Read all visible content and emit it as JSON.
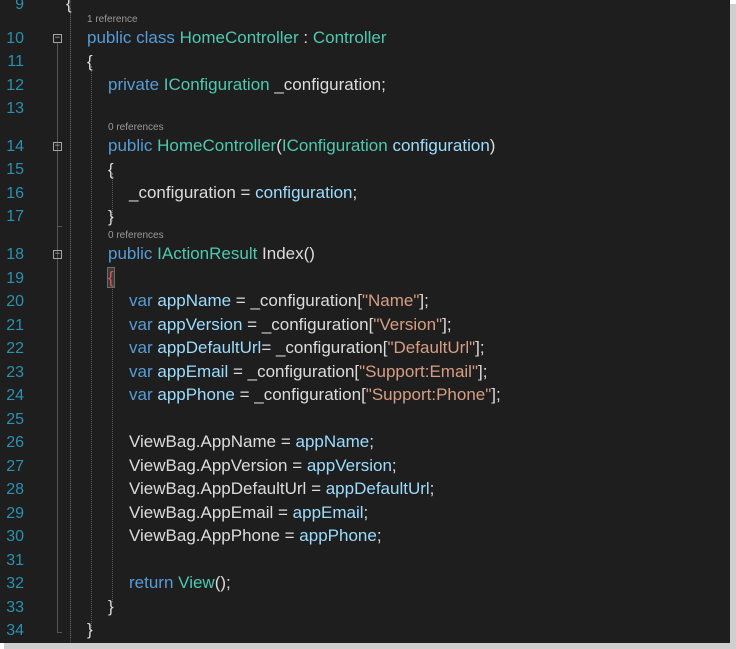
{
  "line_numbers": {
    "l9": "9",
    "l10": "10",
    "l11": "11",
    "l12": "12",
    "l13": "13",
    "l14": "14",
    "l15": "15",
    "l16": "16",
    "l17": "17",
    "l18": "18",
    "l19": "19",
    "l20": "20",
    "l21": "21",
    "l22": "22",
    "l23": "23",
    "l24": "24",
    "l25": "25",
    "l26": "26",
    "l27": "27",
    "l28": "28",
    "l29": "29",
    "l30": "30",
    "l31": "31",
    "l32": "32",
    "l33": "33",
    "l34": "34"
  },
  "codelens": {
    "class_refs": "1 reference",
    "ctor_refs": "0 references",
    "index_refs": "0 references"
  },
  "tokens": {
    "open_brace": "{",
    "close_brace": "}",
    "kw_public": "public",
    "kw_class": "class",
    "kw_private": "private",
    "kw_var": "var",
    "kw_return": "return",
    "home_controller": "HomeController",
    "colon": " : ",
    "controller": "Controller",
    "iconfiguration": "IConfiguration",
    "field_decl": " _configuration;",
    "open_paren": "(",
    "param_configuration": "configuration",
    "close_paren": ")",
    "assign_lhs": "_configuration = ",
    "assign_end": ";",
    "iactionresult": "IActionResult",
    "index_sig": " Index()",
    "app_name": "appName",
    "app_version": "appVersion",
    "app_default_url": "appDefaultUrl",
    "app_email": "appEmail",
    "app_phone": "appPhone",
    "eq": " = ",
    "eq_tight": "= ",
    "config_open": "_configuration[",
    "config_close": "];",
    "str_name": "\"Name\"",
    "str_version": "\"Version\"",
    "str_default_url": "\"DefaultUrl\"",
    "str_support_email": "\"Support:Email\"",
    "str_support_phone": "\"Support:Phone\"",
    "vb_app_name": "ViewBag.AppName",
    "vb_app_version": "ViewBag.AppVersion",
    "vb_app_default_url": "ViewBag.AppDefaultUrl",
    "vb_app_email": "ViewBag.AppEmail",
    "vb_app_phone": "ViewBag.AppPhone",
    "semicolon": ";",
    "view_call": "View",
    "view_call_end": "();"
  },
  "icons": {
    "fold": "collapse-minus-icon"
  },
  "colors": {
    "background": "#1e1e1e",
    "keyword": "#569cd6",
    "type": "#4ec9b0",
    "string": "#d69d85",
    "identifier": "#9cdcfe",
    "text": "#dcdcdc",
    "line_number": "#2b91af"
  }
}
